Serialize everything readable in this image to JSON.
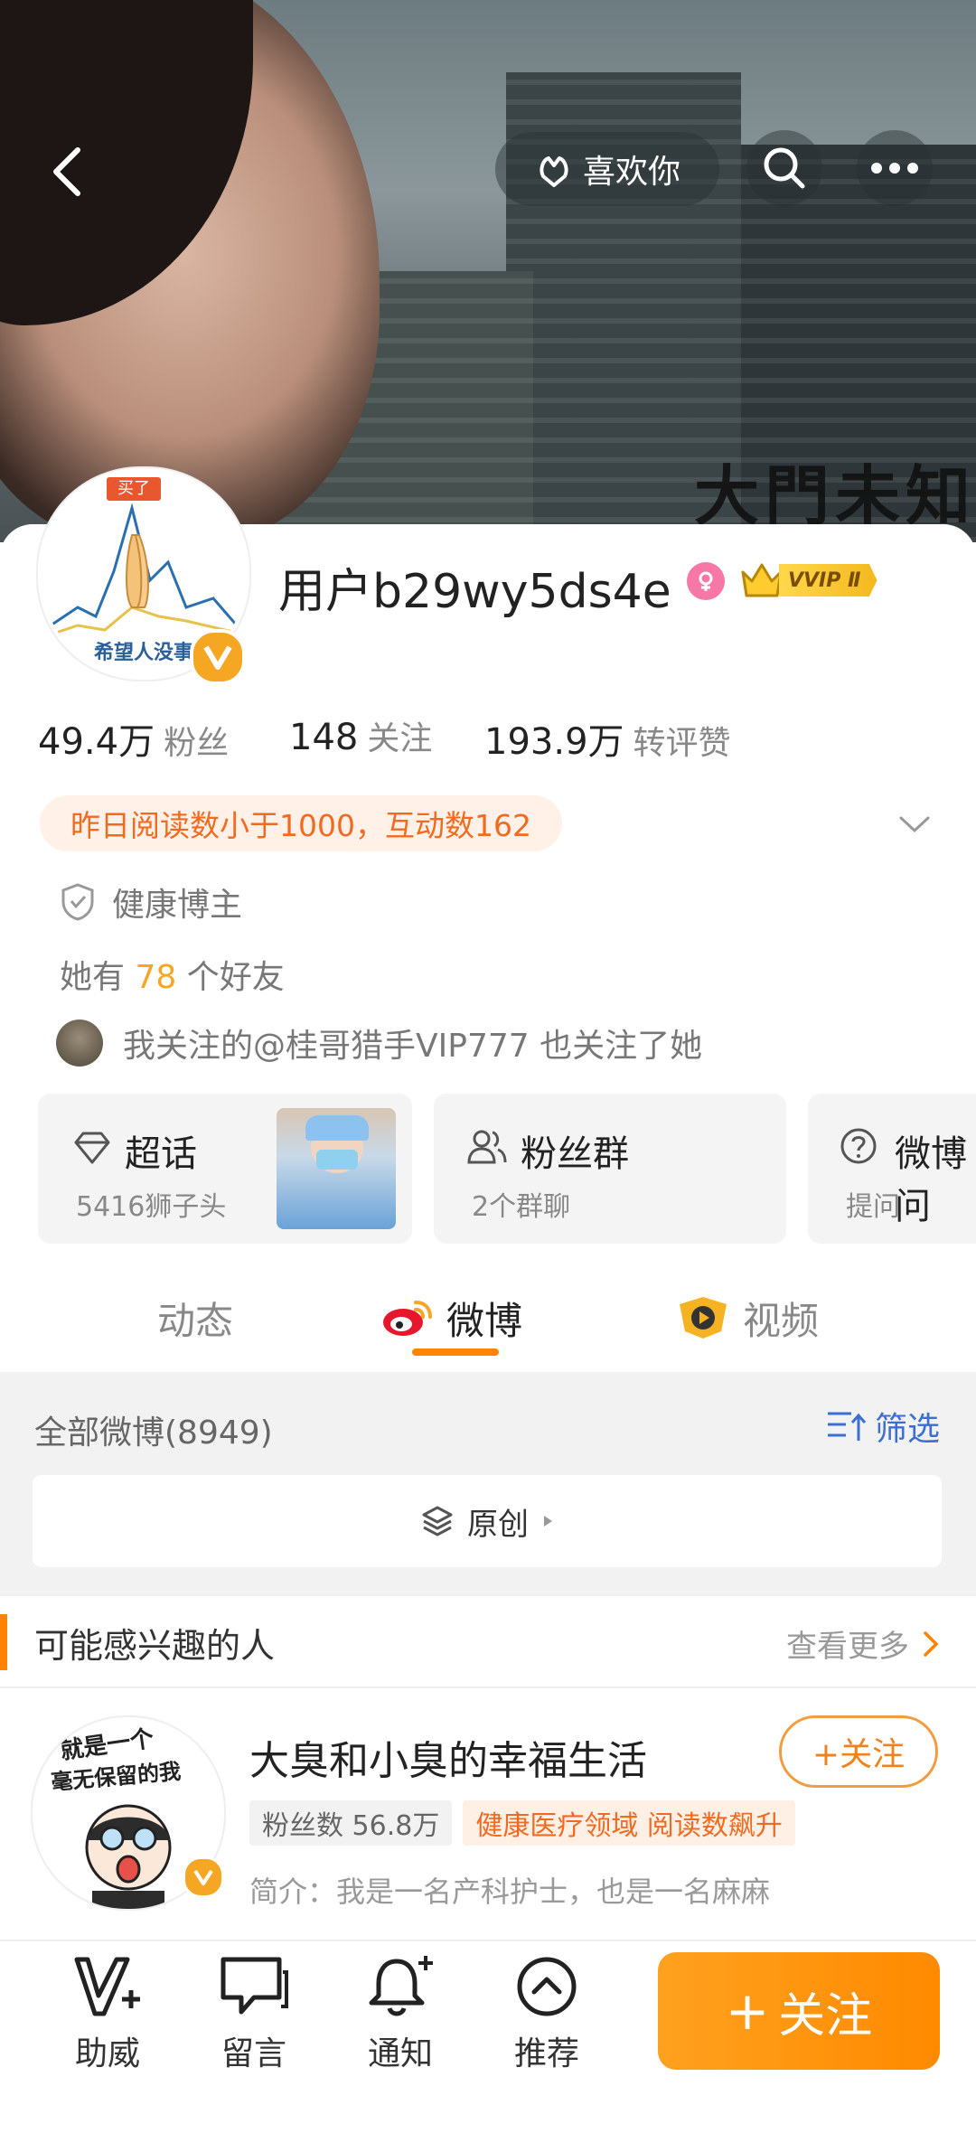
{
  "header": {
    "like_label": "喜欢你",
    "banner_text": "大門未知"
  },
  "profile": {
    "username": "用户b29wy5ds4e",
    "vip_label": "VVIP Ⅱ",
    "avatar_top_text": "买了",
    "avatar_bottom_text": "希望人没事",
    "stats": [
      {
        "value": "49.4万",
        "label": "粉丝"
      },
      {
        "value": "148",
        "label": "关注"
      },
      {
        "value": "193.9万",
        "label": "转评赞"
      }
    ],
    "notice": "昨日阅读数小于1000，互动数162",
    "category": "健康博主",
    "friends_prefix": "她有",
    "friends_count": "78",
    "friends_suffix": "个好友",
    "mutual_text": "我关注的@桂哥猎手VIP777 也关注了她"
  },
  "tiles": [
    {
      "title": "超话",
      "subtitle": "5416狮子头"
    },
    {
      "title": "粉丝群",
      "subtitle": "2个群聊"
    },
    {
      "title": "微博问",
      "subtitle": "提问"
    }
  ],
  "tabs": [
    {
      "label": "动态"
    },
    {
      "label": "微博"
    },
    {
      "label": "视频"
    }
  ],
  "feed": {
    "all_label": "全部微博(8949)",
    "filter_label": "筛选",
    "original_label": "原创"
  },
  "recommend": {
    "header": "可能感兴趣的人",
    "more": "查看更多",
    "avatar_text1": "就是一个",
    "avatar_text2": "毫无保留的我",
    "name": "大臭和小臭的幸福生活",
    "fans_tag": "粉丝数 56.8万",
    "field_tag": "健康医疗领域 阅读数飙升",
    "intro": "简介：我是一名产科护士，也是一名麻麻",
    "follow_label": "+关注"
  },
  "bottom_bar": {
    "items": [
      {
        "label": "助威"
      },
      {
        "label": "留言"
      },
      {
        "label": "通知"
      },
      {
        "label": "推荐"
      }
    ],
    "follow_label": "关注"
  },
  "colors": {
    "accent": "#ff8200",
    "notice_text": "#f06a1f",
    "notice_bg": "#fff1e8",
    "tag_bg": "#f2f2f2",
    "field_tag_bg": "#fff0e6"
  }
}
